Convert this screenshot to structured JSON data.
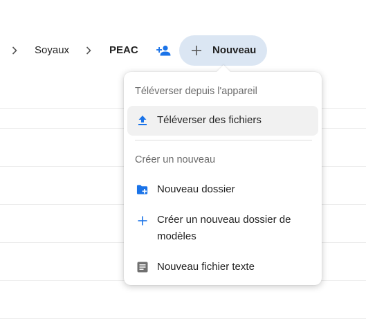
{
  "breadcrumb": {
    "items": [
      "Soyaux",
      "PEAC"
    ]
  },
  "toolbar": {
    "new_label": "Nouveau"
  },
  "menu": {
    "upload_section_title": "Téléverser depuis l'appareil",
    "upload_files_label": "Téléverser des fichiers",
    "create_section_title": "Créer un nouveau",
    "new_folder_label": "Nouveau dossier",
    "new_template_folder_label": "Créer un nouveau dossier de modèles",
    "new_text_file_label": "Nouveau fichier texte"
  },
  "colors": {
    "accent": "#1a73e8",
    "new_button_bg": "#dbe6f3"
  },
  "icons": {
    "upload": "upload-icon",
    "folder_plus": "folder-plus-icon",
    "plus": "plus-icon",
    "text_file": "text-file-icon",
    "share": "share-user-icon",
    "chevron": "chevron-right-icon"
  }
}
